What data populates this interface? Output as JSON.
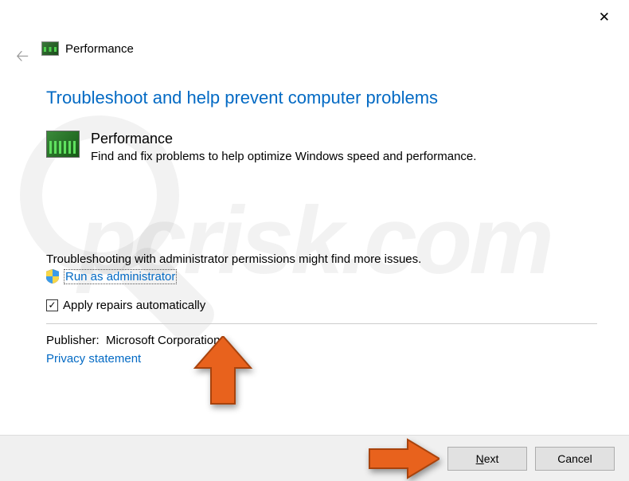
{
  "header": {
    "title": "Performance"
  },
  "main": {
    "heading": "Troubleshoot and help prevent computer problems",
    "perf_title": "Performance",
    "perf_desc": "Find and fix problems to help optimize Windows speed and performance.",
    "admin_note": "Troubleshooting with administrator permissions might find more issues.",
    "admin_link": "Run as administrator",
    "apply_repairs_label": "Apply repairs automatically",
    "apply_repairs_checked": true,
    "publisher_label": "Publisher:",
    "publisher_value": "Microsoft Corporation",
    "privacy_link": "Privacy statement"
  },
  "footer": {
    "next_label": "Next",
    "cancel_label": "Cancel"
  },
  "watermark": "pcrisk.com"
}
